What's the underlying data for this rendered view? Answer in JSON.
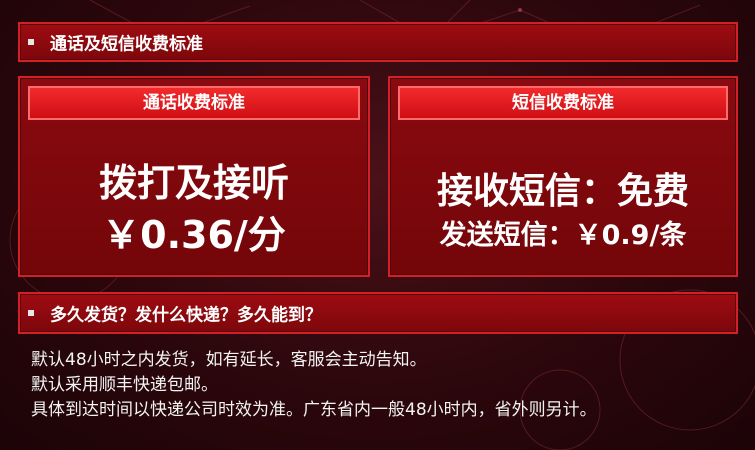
{
  "header_bar": {
    "title": "通话及短信收费标准"
  },
  "call_panel": {
    "heading": "通话收费标准",
    "line1": "拨打及接听",
    "line2": "￥0.36/分"
  },
  "sms_panel": {
    "heading": "短信收费标准",
    "line1": "接收短信：免费",
    "line2": "发送短信：￥0.9/条"
  },
  "shipping_bar": {
    "title": "多久发货？发什么快递？多久能到？"
  },
  "shipping_info": {
    "lines": [
      "默认48小时之内发货，如有延长，客服会主动告知。",
      "默认采用顺丰快递包邮。",
      "具体到达时间以快递公司时效为准。广东省内一般48小时内，省外则另计。"
    ]
  },
  "colors": {
    "bar_fill": "#9e0c12",
    "border": "#d21f28",
    "heading_fill": "#e01a1f",
    "background": "#2c070c"
  }
}
